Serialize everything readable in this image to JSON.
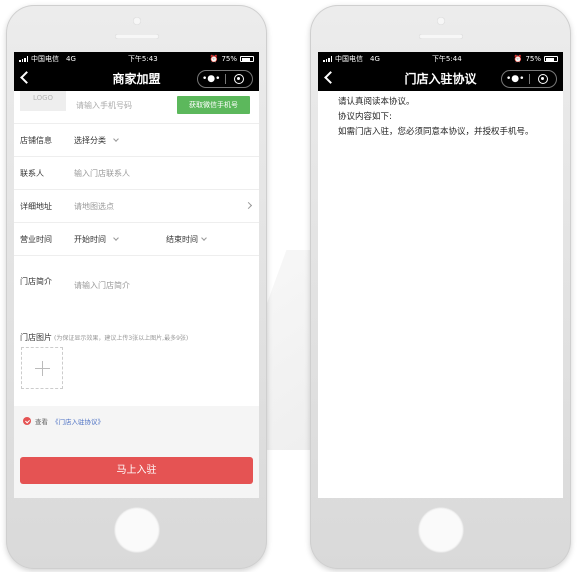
{
  "status_left": {
    "carrier": "中国电信",
    "network": "4G",
    "time": "下午5:43",
    "battery": "75%"
  },
  "status_right": {
    "carrier": "中国电信",
    "network": "4G",
    "time": "下午5:44",
    "battery": "75%"
  },
  "left_screen": {
    "title": "商家加盟",
    "capsule_more": "•●•",
    "logo_placeholder": "LOGO",
    "phone_placeholder": "请输入手机号码",
    "wx_phone_button": "获取微信手机号",
    "category": {
      "label": "店铺信息",
      "value": "选择分类"
    },
    "contact": {
      "label": "联系人",
      "placeholder": "输入门店联系人"
    },
    "address": {
      "label": "详细地址",
      "placeholder": "请地图选点"
    },
    "hours": {
      "label": "营业时间",
      "start": "开始时间",
      "end": "结束时间"
    },
    "intro": {
      "label": "门店简介",
      "placeholder": "请输入门店简介"
    },
    "photos": {
      "label": "门店图片",
      "hint": "(为保证显示效果，建议上传3张以上图片,最多9张)"
    },
    "agree_prefix": "查看",
    "agree_link": "《门店入驻协议》",
    "submit": "马上入驻"
  },
  "right_screen": {
    "title": "门店入驻协议",
    "capsule_more": "•●•",
    "paragraphs": [
      "请认真阅读本协议。",
      "协议内容如下:",
      "如需门店入驻，您必须同意本协议，并授权手机号。"
    ]
  },
  "colors": {
    "primary_red": "#e55353",
    "wx_green": "#5cb85c",
    "link_blue": "#4a6fc3",
    "nav_black": "#000000"
  }
}
